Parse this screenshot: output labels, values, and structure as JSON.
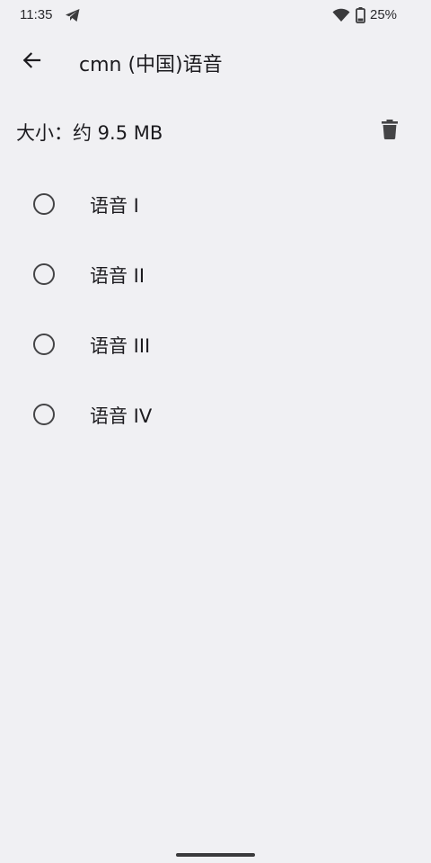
{
  "status_bar": {
    "time": "11:35",
    "battery_percent": "25%",
    "battery_level": 0.25,
    "icons": [
      "telegram-icon",
      "wifi-icon",
      "battery-icon"
    ]
  },
  "app_bar": {
    "back_icon": "arrow-back-icon",
    "title": "cmn (中国)语音"
  },
  "size_row": {
    "text": "大小：约 9.5 MB",
    "delete_icon": "trash-icon"
  },
  "voices": [
    {
      "label": "语音 I",
      "selected": false
    },
    {
      "label": "语音 II",
      "selected": false
    },
    {
      "label": "语音 III",
      "selected": false
    },
    {
      "label": "语音 IV",
      "selected": false
    }
  ],
  "colors": {
    "background": "#f0f0f3",
    "text": "#1c1b1f",
    "icon": "#444446"
  }
}
